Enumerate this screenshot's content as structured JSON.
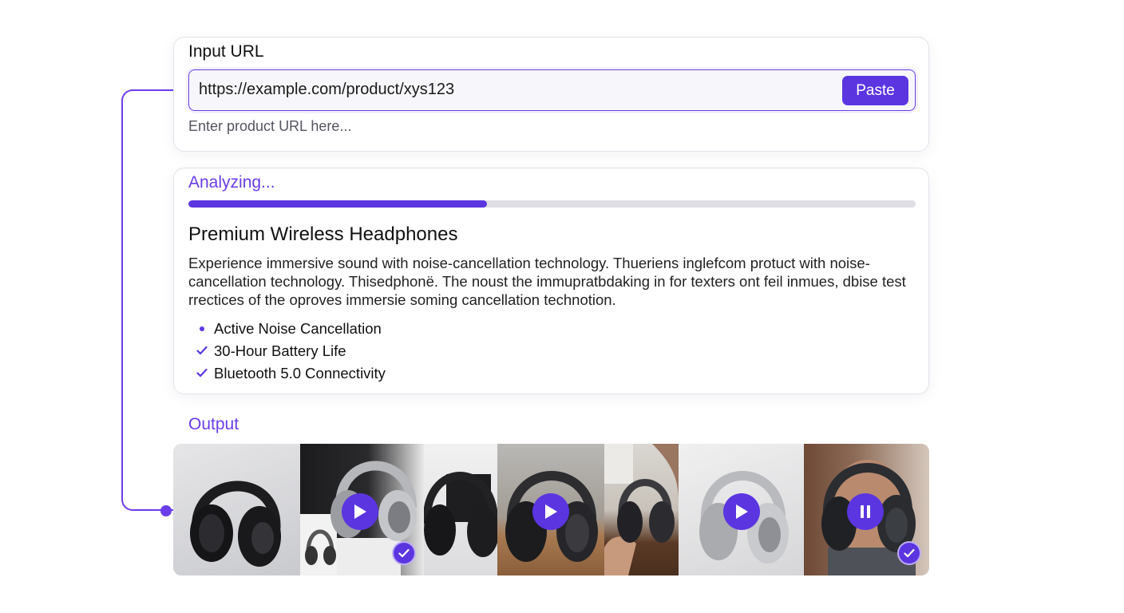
{
  "input": {
    "title": "Input URL",
    "url_value": "https://example.com/product/xys123",
    "paste_label": "Paste",
    "hint": "Enter product URL here..."
  },
  "analysis": {
    "status": "Analyzing...",
    "progress": 0.41,
    "product_title": "Premium Wireless Headphones",
    "description": "Experience immersive sound with noise-cancellation technology. Thueriens inglefcom protuct with noise-cancellation technology. Thisedphonë. The noust the immupratbdaking in for texters ont feil inmues, dbise test rrectices of the oproves immersie soming cancellation technotion.",
    "features": [
      {
        "label": "Active Noise Cancellation",
        "marker": "dot"
      },
      {
        "label": "30-Hour Battery Life",
        "marker": "check"
      },
      {
        "label": "Bluetooth 5.0 Connectivity",
        "marker": "check"
      }
    ]
  },
  "output": {
    "title": "Output",
    "thumbnails": [
      {
        "name": "thumb-black-headphones-studio",
        "overlay": "none",
        "selected": false
      },
      {
        "name": "thumb-silver-headphones-box",
        "overlay": "play-icon",
        "selected": true
      },
      {
        "name": "thumb-black-headphones-display",
        "overlay": "none",
        "selected": false
      },
      {
        "name": "thumb-dark-headphones-wood",
        "overlay": "play-icon",
        "selected": false
      },
      {
        "name": "thumb-headphones-on-desk",
        "overlay": "none",
        "selected": false
      },
      {
        "name": "thumb-silver-headphones-white",
        "overlay": "play-icon",
        "selected": false
      },
      {
        "name": "thumb-person-with-headphones",
        "overlay": "pause-icon",
        "selected": true
      }
    ]
  },
  "colors": {
    "accent": "#5b35e0",
    "accent_light": "#6a3de8",
    "track": "#dedee4",
    "border": "#e3e3ea"
  }
}
